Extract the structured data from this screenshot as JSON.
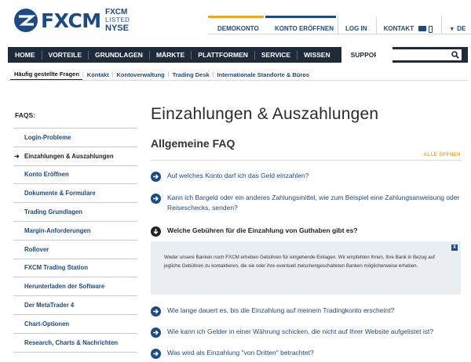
{
  "brand": {
    "name": "FXCM",
    "listed_line1": "FXCM",
    "listed_line2": "LISTED",
    "listed_line3": "NYSE"
  },
  "topnav": {
    "demo": "DEMOKONTO",
    "open_account": "KONTO ERÖFFNEN",
    "login": "LOG IN",
    "contact": "KONTAKT",
    "lang_caret": "▼",
    "language": "DE"
  },
  "mainnav": {
    "items": [
      "HOME",
      "VORTEILE",
      "GRUNDLAGEN",
      "MÄRKTE",
      "PLATTFORMEN",
      "SERVICE",
      "WISSEN"
    ],
    "active": "SUPPORT",
    "search_placeholder": ""
  },
  "subnav": {
    "items": [
      "Häufig gestellte Fragen",
      "Kontakt",
      "Kontoverwaltung",
      "Trading Desk",
      "Internationale Standorte & Büros"
    ],
    "separator": "|"
  },
  "sidebar": {
    "heading": "FAQS:",
    "active_marker": "➜",
    "items": [
      "Login-Probleme",
      "Einzahlungen & Auszahlungen",
      "Konto Eröffnen",
      "Dokumente & Formulare",
      "Trading Grundlagen",
      "Margin-Anforderungen",
      "Rollover",
      "FXCM Trading Station",
      "Herunterladen der Software",
      "Der MetaTrader 4",
      "Chart-Optionen",
      "Research, Charts & Nachrichten"
    ],
    "active_index": 1
  },
  "main": {
    "title": "Einzahlungen & Auszahlungen",
    "section": "Allgemeine FAQ",
    "open_all": "ALLE ÖFFNEN",
    "faqs": [
      {
        "q": "Auf welches Konto darf ich das Geld einzahlen?",
        "open": false
      },
      {
        "q": "Kann ich Bargeld oder ein anderes Zahlungsmittel, wie zum Beispiel eine Zahlungsanweisung oder Reiseschecks, senden?",
        "open": false
      },
      {
        "q": "Welche Gebühren für die Einzahlung von Guthaben gibt es?",
        "open": true
      },
      {
        "q": "Wie lange dauert es, bis die Einzahlung auf meinem Tradingkonto erscheint?",
        "open": false
      },
      {
        "q": "Wie kann ich Gelder in einer Währung schicken, die nicht auf Ihrer Website aufgelistet ist?",
        "open": false
      },
      {
        "q": "Was wird als Einzahlung \"von Dritten\" betrachtet?",
        "open": false
      }
    ],
    "answer_close": "X",
    "answer": "Weder unsere Banken noch FXCM erheben Gebühren für eingehende Einlagen. Wir empfehlen Ihnen, Ihre Bank in Bezug auf jegliche Gebühren zu kontaktieren, die sie oder ihre eventuell zwischengeschalteten Banken möglicherweise erheben."
  },
  "colors": {
    "brand_blue": "#1c4a86",
    "nav_dark": "#1e2b3a",
    "accent_orange": "#f0a51a",
    "answer_bg": "#e9eef3"
  }
}
